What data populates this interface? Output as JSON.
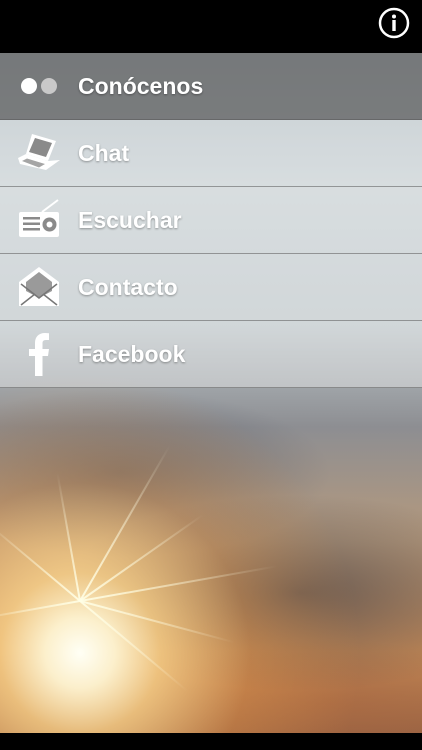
{
  "menu": {
    "items": [
      {
        "label": "Conócenos",
        "icon": "dots-icon",
        "active": true
      },
      {
        "label": "Chat",
        "icon": "laptop-icon",
        "active": false
      },
      {
        "label": "Escuchar",
        "icon": "radio-icon",
        "active": false
      },
      {
        "label": "Contacto",
        "icon": "envelope-icon",
        "active": false
      },
      {
        "label": "Facebook",
        "icon": "facebook-icon",
        "active": false
      }
    ]
  },
  "header": {
    "info_icon": "info-icon"
  },
  "colors": {
    "topbar": "#000000",
    "active_row": "#696969",
    "label": "#ffffff"
  }
}
